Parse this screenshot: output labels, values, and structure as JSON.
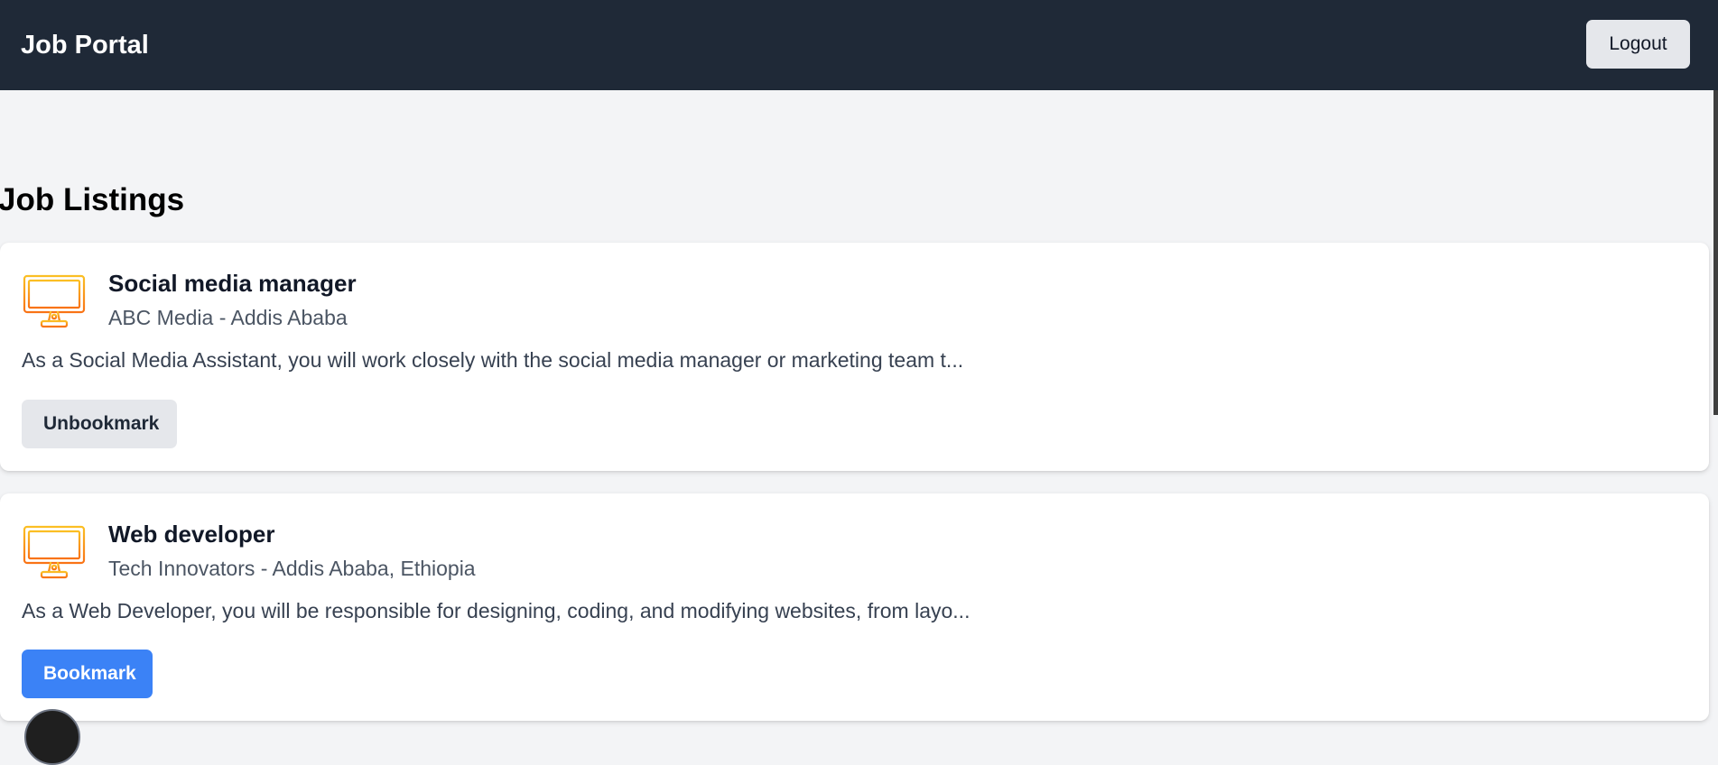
{
  "navbar": {
    "brand": "Job Portal",
    "logout_label": "Logout"
  },
  "page": {
    "heading": "Job Listings"
  },
  "icons": {
    "job_icon": "monitor-icon",
    "accent_gradient": [
      "#fbbf24",
      "#f97316"
    ]
  },
  "jobs": [
    {
      "title": "Social media manager",
      "company_location": "ABC Media - Addis Ababa",
      "description": "As a Social Media Assistant, you will work closely with the social media manager or marketing team t...",
      "bookmark_label": "Unbookmark",
      "bookmarked": true
    },
    {
      "title": "Web developer",
      "company_location": "Tech Innovators - Addis Ababa, Ethiopia",
      "description": "As a Web Developer, you will be responsible for designing, coding, and modifying websites, from layo...",
      "bookmark_label": "Bookmark",
      "bookmarked": false
    }
  ],
  "colors": {
    "navbar_bg": "#1f2937",
    "page_bg": "#f3f4f6",
    "primary": "#3b82f6",
    "secondary_btn": "#e5e7eb"
  }
}
